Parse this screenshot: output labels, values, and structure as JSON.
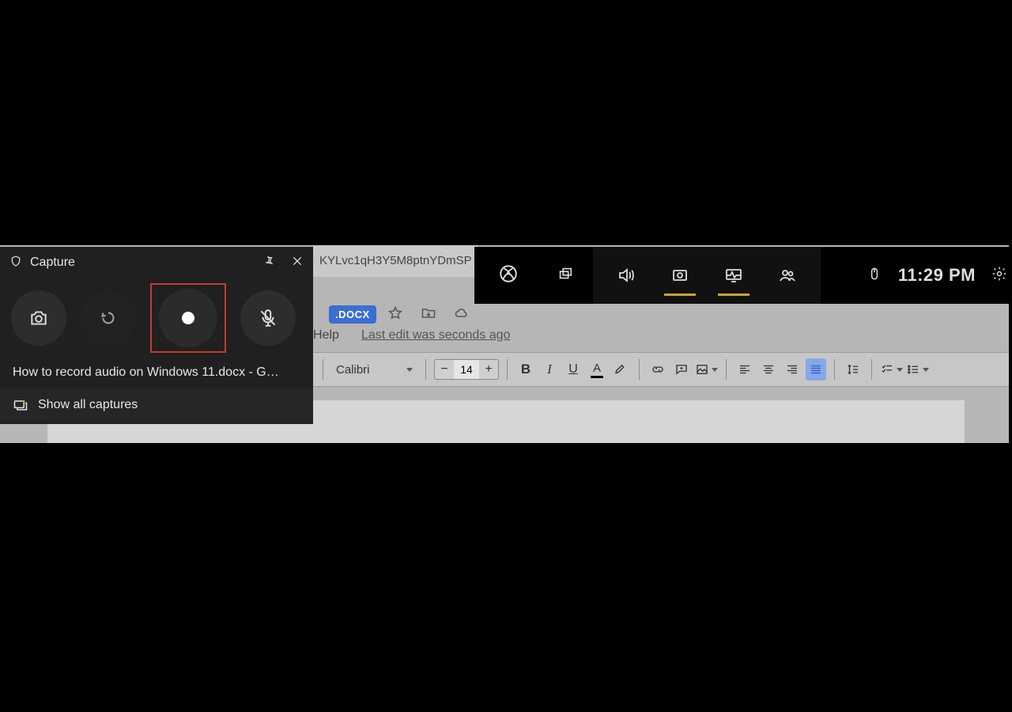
{
  "capture": {
    "title": "Capture",
    "target_window": "How to record audio on Windows 11.docx - G…",
    "show_all": "Show all captures"
  },
  "gamebar": {
    "time": "11:29 PM"
  },
  "docs": {
    "url_fragment": "KYLvc1qH3Y5M8ptnYDmSP",
    "badge": ".DOCX",
    "menu_help": "Help",
    "edit_ago": "Last edit was seconds ago",
    "font_name": "Calibri",
    "font_size": "14"
  }
}
